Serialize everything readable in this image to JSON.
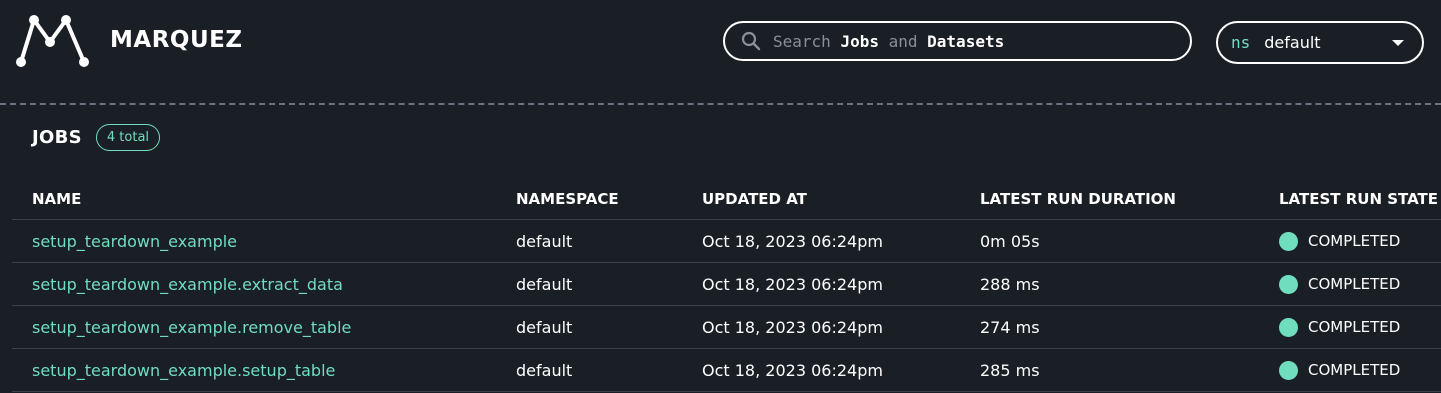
{
  "app": {
    "brand": "MARQUEZ"
  },
  "search": {
    "prefix": "Search",
    "jobs": "Jobs",
    "and": "and",
    "datasets": "Datasets"
  },
  "namespace": {
    "prefix": "ns",
    "value": "default"
  },
  "jobs": {
    "title": "JOBS",
    "count_badge": "4 total",
    "columns": [
      "NAME",
      "NAMESPACE",
      "UPDATED AT",
      "LATEST RUN DURATION",
      "LATEST RUN STATE"
    ],
    "rows": [
      {
        "name": "setup_teardown_example",
        "namespace": "default",
        "updated_at": "Oct 18, 2023 06:24pm",
        "duration": "0m 05s",
        "state": "COMPLETED"
      },
      {
        "name": "setup_teardown_example.extract_data",
        "namespace": "default",
        "updated_at": "Oct 18, 2023 06:24pm",
        "duration": "288 ms",
        "state": "COMPLETED"
      },
      {
        "name": "setup_teardown_example.remove_table",
        "namespace": "default",
        "updated_at": "Oct 18, 2023 06:24pm",
        "duration": "274 ms",
        "state": "COMPLETED"
      },
      {
        "name": "setup_teardown_example.setup_table",
        "namespace": "default",
        "updated_at": "Oct 18, 2023 06:24pm",
        "duration": "285 ms",
        "state": "COMPLETED"
      }
    ]
  },
  "colors": {
    "background": "#1a1f26",
    "accent": "#71ddbf",
    "text": "#ffffff",
    "muted": "#8a9099"
  },
  "icons": {
    "logo": "marquez-logo-icon",
    "search": "search-icon",
    "dropdown": "chevron-down-icon",
    "state": "status-dot-icon"
  }
}
